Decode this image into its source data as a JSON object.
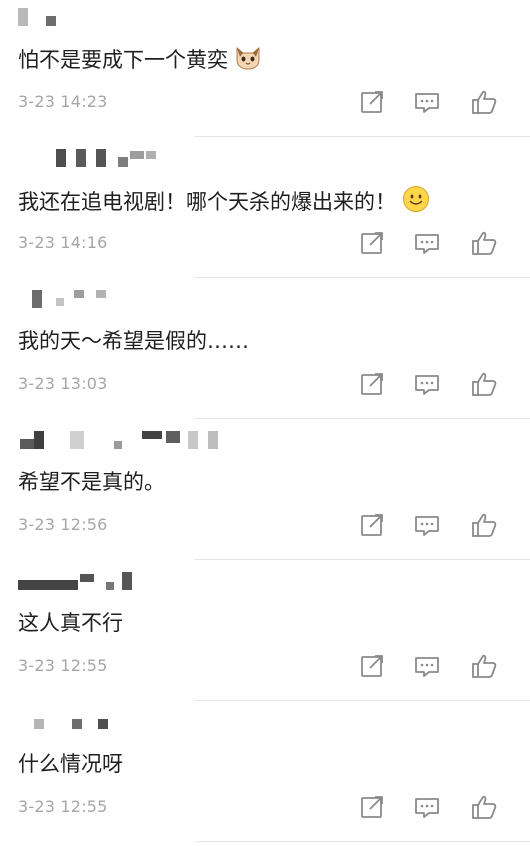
{
  "comments": [
    {
      "text": "怕不是要成下一个黄奕",
      "time": "3-23 14:23",
      "emoji": "cat-face-icon"
    },
    {
      "text": "我还在追电视剧！哪个天杀的爆出来的！",
      "time": "3-23 14:16",
      "emoji": "smiling-face-icon"
    },
    {
      "text": "我的天～希望是假的……",
      "time": "3-23 13:03"
    },
    {
      "text": "希望不是真的。",
      "time": "3-23 12:56"
    },
    {
      "text": "这人真不行",
      "time": "3-23 12:55"
    },
    {
      "text": "什么情况呀",
      "time": "3-23 12:55"
    }
  ],
  "icons": {
    "share": "share-icon",
    "reply": "reply-icon",
    "like": "thumbs-up-icon"
  },
  "colors": {
    "text": "#1f1f1f",
    "timestamp": "#a6a6a6",
    "icon": "#8a8a8a",
    "divider": "#e6e6e6",
    "username_blur": "#9a9a9a"
  }
}
